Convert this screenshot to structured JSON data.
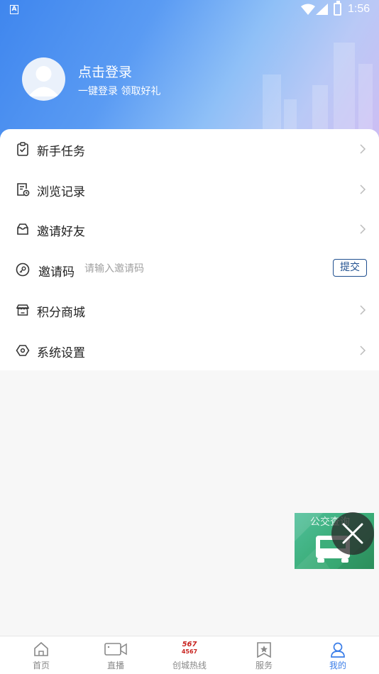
{
  "status_bar": {
    "app_indicator": "A",
    "time": "1:56"
  },
  "profile": {
    "title": "点击登录",
    "subtitle": "一键登录  领取好礼"
  },
  "menu": [
    {
      "label": "新手任务",
      "icon": "clipboard-check-icon"
    },
    {
      "label": "浏览记录",
      "icon": "history-doc-icon"
    },
    {
      "label": "邀请好友",
      "icon": "envelope-icon"
    },
    {
      "label": "邀请码",
      "icon": "key-icon",
      "placeholder": "请输入邀请码",
      "button": "提交"
    },
    {
      "label": "积分商城",
      "icon": "store-icon"
    },
    {
      "label": "系统设置",
      "icon": "settings-hexagon-icon"
    }
  ],
  "bus_widget": {
    "label": "公交查询"
  },
  "tabs": [
    {
      "label": "首页",
      "icon": "home-icon"
    },
    {
      "label": "直播",
      "icon": "video-camera-icon"
    },
    {
      "label": "创城热线",
      "icon": "hotline-logo-icon",
      "logo_text_top": "567",
      "logo_text_bottom": "4567"
    },
    {
      "label": "服务",
      "icon": "star-bookmark-icon"
    },
    {
      "label": "我的",
      "icon": "user-icon",
      "active": true
    }
  ],
  "colors": {
    "accent": "#3a7de8",
    "submit_border": "#1f4f8f",
    "widget_green": "#3cae7a"
  }
}
